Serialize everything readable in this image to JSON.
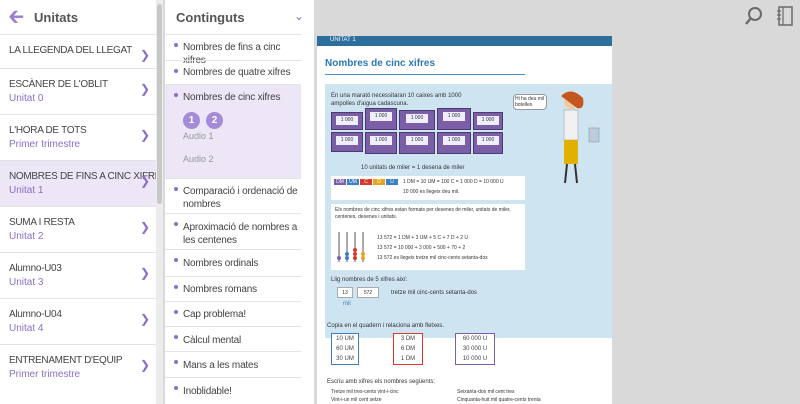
{
  "header": {
    "title": "Unitats",
    "back_icon": "arrow-left-icon"
  },
  "units": [
    {
      "title": "LA LLEGENDA DEL LLEGAT",
      "subtitle": ""
    },
    {
      "title": "ESCÀNER DE L'OBLIT",
      "subtitle": "Unitat 0"
    },
    {
      "title": "L'HORA DE TOTS",
      "subtitle": "Primer trimestre"
    },
    {
      "title": "NOMBRES DE FINS A CINC XIFRES",
      "subtitle": "Unitat 1"
    },
    {
      "title": "SUMA I RESTA",
      "subtitle": "Unitat 2"
    },
    {
      "title": "Alumno-U03",
      "subtitle": "Unitat 3"
    },
    {
      "title": "Alumno-U04",
      "subtitle": "Unitat 4"
    },
    {
      "title": "ENTRENAMENT D'EQUIP",
      "subtitle": "Primer trimestre"
    }
  ],
  "contents": {
    "title": "Continguts",
    "items": [
      "Nombres de fins a cinc xifres",
      "Nombres de quatre xifres",
      "Nombres de cinc xifres",
      "Comparació i ordenació de nombres",
      "Aproximació de nombres a les centenes",
      "Nombres ordinals",
      "Nombres romans",
      "Cap problema!",
      "Càlcul mental",
      "Mans a les mates",
      "Inoblidable!"
    ],
    "audio_buttons": [
      "1",
      "2"
    ],
    "audio_labels": [
      "Audio 1",
      "Audio 2"
    ]
  },
  "toolbar": {
    "search_icon": "search-icon",
    "book_icon": "notebook-icon"
  },
  "page": {
    "bar_text": "UNITAT 1",
    "title": "Nombres de cinc xifres",
    "intro": "En una marató necessitaran 10 caixes amb 1000 ampolles d'aigua cadascuna.",
    "bubble": "Hi ha deu mil botelles",
    "boxes_label": "1 000",
    "boxes_caption": "10 unitats de miler = 1 desena de miler",
    "place_headers": [
      "DM",
      "UM",
      "C",
      "D",
      "U"
    ],
    "equivalence": "1 DM = 10 UM = 100 C = 1 000 D = 10 000 U",
    "equivalence_read": "10 000 es llegeix deu mil.",
    "rule": "Els nombres de cinc xifres estan formats per desenes de miler, unitats de miler, centenes, desenes i unitats.",
    "decomp1": "13 572 = 1 DM + 3 UM + 5 C + 7 D + 2 U",
    "decomp2": "13 572 = 10 000 + 3 000 + 500 + 70 + 2",
    "decomp3": "13 572 es llegeix tretze mil cinc-cents setanta-dos",
    "read_title": "Llig nombres de 5 xifres així:",
    "read_parts": [
      "13",
      "572"
    ],
    "read_word": "mil",
    "read_result": "tretze mil cinc-cents setanta-dos",
    "exercise1": "Copia en el quadern i relaciona amb fletxes.",
    "col1": [
      "10 UM",
      "60 UM",
      "30 UM"
    ],
    "col2": [
      "3 DM",
      "6 DM",
      "1 DM"
    ],
    "col3": [
      "60 000 U",
      "30 000 U",
      "10 000 U"
    ],
    "exercise2": "Escriu amb xifres els nombres següents:",
    "ex2_items": [
      "Tretze mil tres-cents vint-i-cinc",
      "Vint-i-un mil cent setze",
      "Seixanta-dos mil cent tres",
      "Cinquanta-huit mil quatre-cents trenta"
    ]
  }
}
